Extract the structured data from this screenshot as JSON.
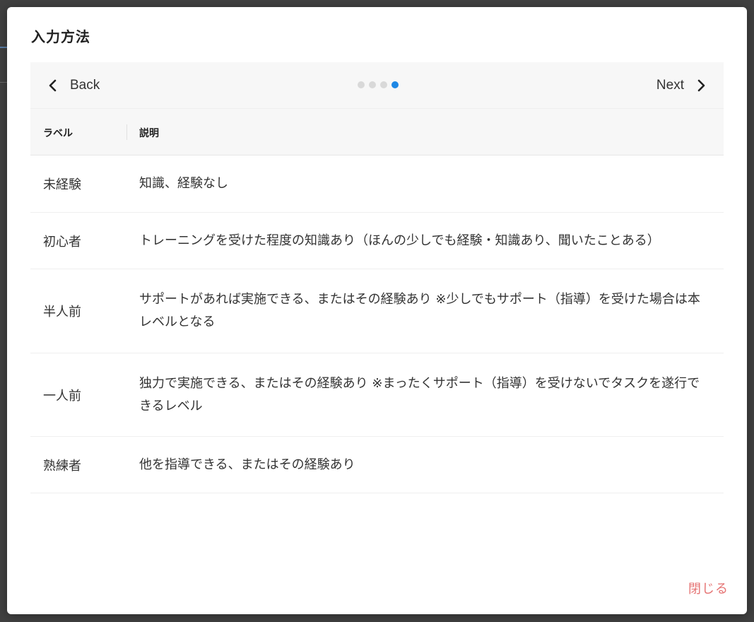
{
  "modal": {
    "title": "入力方法",
    "close_label": "閉じる"
  },
  "carousel": {
    "back_label": "Back",
    "next_label": "Next",
    "page_count": 4,
    "active_page": 4
  },
  "table": {
    "headers": {
      "label": "ラベル",
      "description": "説明"
    },
    "rows": [
      {
        "label": "未経験",
        "description": "知識、経験なし"
      },
      {
        "label": "初心者",
        "description": "トレーニングを受けた程度の知識あり（ほんの少しでも経験・知識あり、聞いたことある）"
      },
      {
        "label": "半人前",
        "description": "サポートがあれば実施できる、またはその経験あり ※少しでもサポート（指導）を受けた場合は本レベルとなる"
      },
      {
        "label": "一人前",
        "description": "独力で実施できる、またはその経験あり ※まったくサポート（指導）を受けないでタスクを遂行できるレベル"
      },
      {
        "label": "熟練者",
        "description": "他を指導できる、またはその経験あり"
      }
    ]
  },
  "colors": {
    "accent_dot": "#1e88e5",
    "close_text": "#e57373"
  },
  "icons": {
    "back": "chevron-left-icon",
    "next": "chevron-right-icon"
  }
}
